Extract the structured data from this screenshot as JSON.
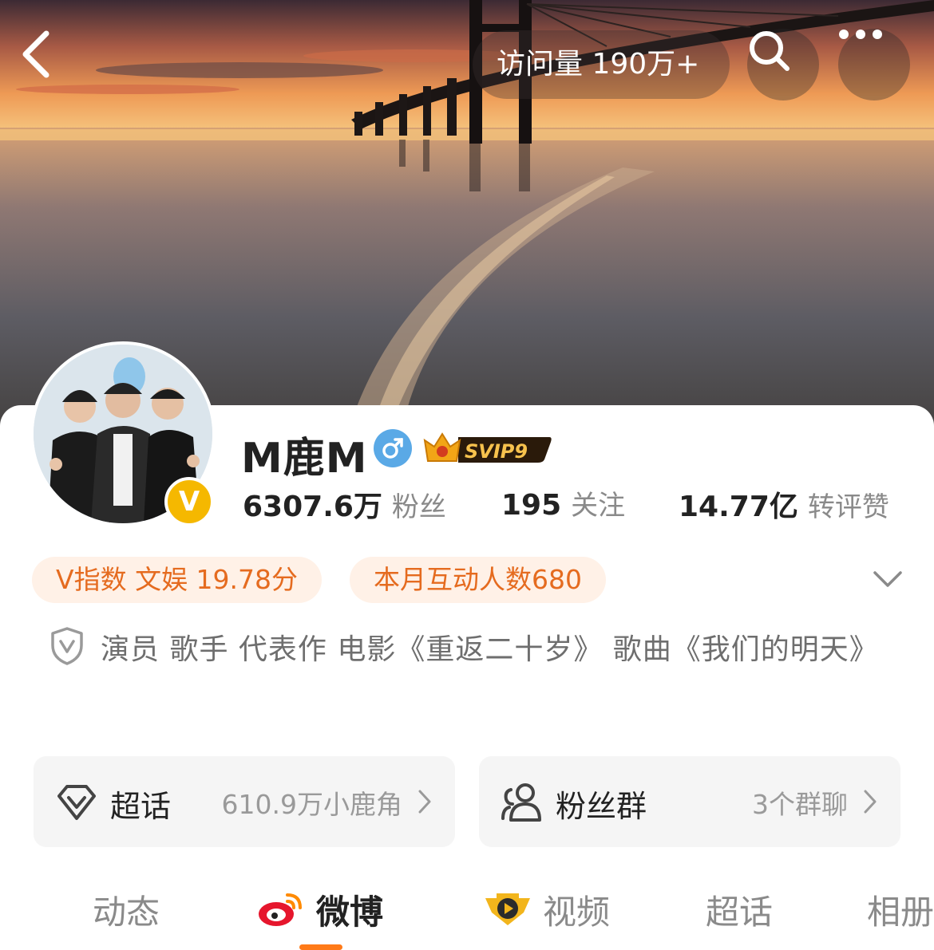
{
  "header": {
    "visits": "访问量 190万+"
  },
  "profile": {
    "name": "M鹿M",
    "gender": "male",
    "vip_badge": "SVIP9",
    "verified": "V",
    "stats": [
      {
        "num": "6307.6万",
        "label": "粉丝"
      },
      {
        "num": "195",
        "label": "关注"
      },
      {
        "num": "14.77亿",
        "label": "转评赞"
      }
    ],
    "pills": [
      "V指数 文娱 19.78分",
      "本月互动人数680"
    ],
    "bio": "演员 歌手 代表作 电影《重返二十岁》 歌曲《我们的明天》"
  },
  "tiles": [
    {
      "title": "超话",
      "meta": "610.9万小鹿角",
      "icon": "diamond-icon"
    },
    {
      "title": "粉丝群",
      "meta": "3个群聊",
      "icon": "group-icon"
    }
  ],
  "tabs": [
    "动态",
    "微博",
    "视频",
    "超话",
    "相册"
  ],
  "active_tab": "微博",
  "colors": {
    "accent": "#ff7a18",
    "pill_text": "#e56b1f",
    "pill_bg": "#fff1e7",
    "gender": "#5aa9e6",
    "verified": "#f5b800"
  }
}
